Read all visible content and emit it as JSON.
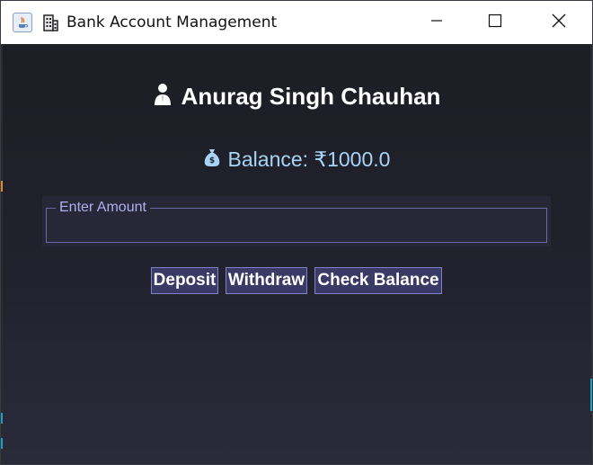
{
  "window": {
    "title": "Bank Account Management",
    "app_icon": "java-icon",
    "title_icon": "building-icon",
    "controls": {
      "minimize": "minimize-icon",
      "maximize": "maximize-icon",
      "close": "close-icon"
    }
  },
  "account": {
    "user_icon": "person-icon",
    "name": "Anurag Singh Chauhan",
    "balance_icon": "money-bag-icon",
    "balance_label": "Balance: ₹1000.0"
  },
  "amount_field": {
    "legend": "Enter Amount",
    "value": ""
  },
  "actions": {
    "deposit": "Deposit",
    "withdraw": "Withdraw",
    "check_balance": "Check Balance"
  },
  "colors": {
    "background": "#202028",
    "name_text": "#ffffff",
    "balance_text": "#a8d4f6",
    "legend_text": "#b0b0f0",
    "button_bg": "#3a3a66",
    "button_border": "#8080c8"
  }
}
